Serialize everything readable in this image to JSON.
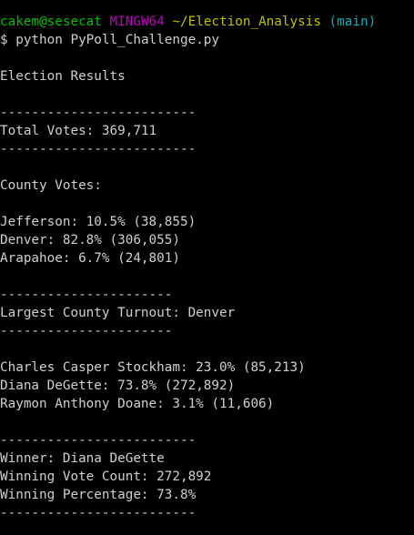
{
  "prompt": {
    "user": "cakem@sesecat",
    "system": "MINGW64",
    "path": "~/Election_Analysis",
    "branch": "(main)",
    "symbol": "$",
    "command": "python PyPoll_Challenge.py"
  },
  "colors": {
    "user": "#00c000",
    "system": "#c000c0",
    "path": "#c0c000",
    "branch": "#00b0c0",
    "text": "#cfcfcf",
    "background": "#000000"
  },
  "output": {
    "title": "Election Results",
    "separator_long": "-------------------------",
    "separator_short": "----------------------",
    "total_votes": "Total Votes: 369,711",
    "county_header": "County Votes:",
    "counties": [
      "Jefferson: 10.5% (38,855)",
      "Denver: 82.8% (306,055)",
      "Arapahoe: 6.7% (24,801)"
    ],
    "largest_county": "Largest County Turnout: Denver",
    "candidates": [
      "Charles Casper Stockham: 23.0% (85,213)",
      "Diana DeGette: 73.8% (272,892)",
      "Raymon Anthony Doane: 3.1% (11,606)"
    ],
    "winner": "Winner: Diana DeGette",
    "winning_count": "Winning Vote Count: 272,892",
    "winning_percentage": "Winning Percentage: 73.8%"
  }
}
